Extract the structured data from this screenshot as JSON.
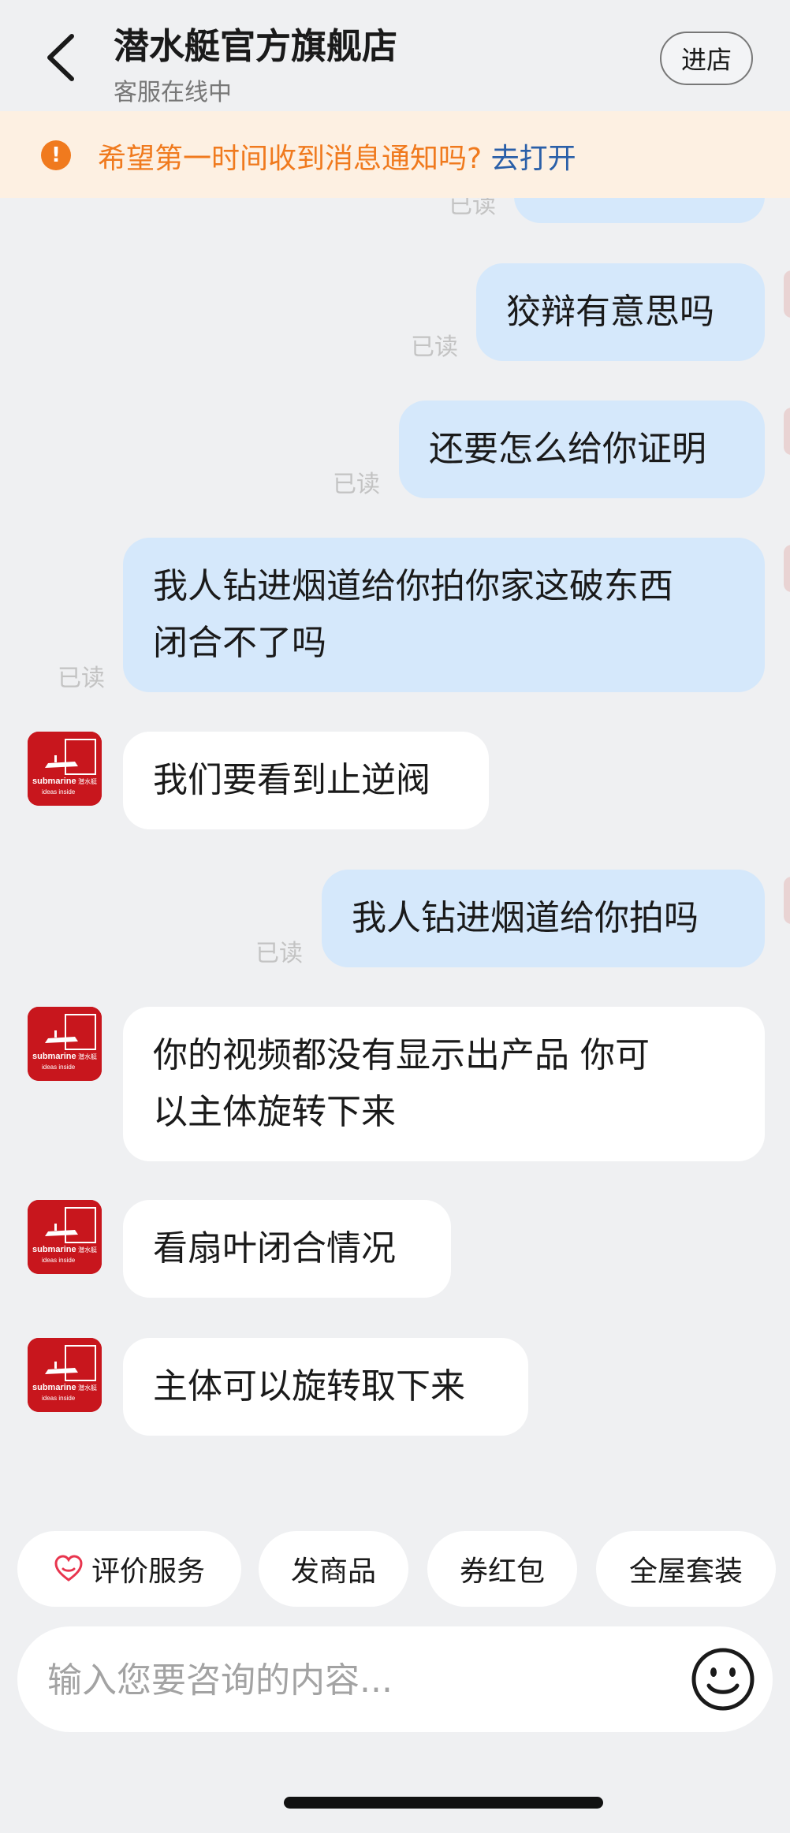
{
  "header": {
    "back_icon": "chevron-left-icon",
    "title": "潜水艇官方旗舰店",
    "status": "客服在线中",
    "enter_store_label": "进店"
  },
  "notice": {
    "icon": "alert-circle-icon",
    "text": "希望第一时间收到消息通知吗?",
    "link_text": "去打开",
    "color": "#f07a1e",
    "link_color": "#2a5fa8"
  },
  "messages": [
    {
      "sender": "user",
      "text": "",
      "read_label": "已读"
    },
    {
      "sender": "user",
      "text": "狡辩有意思吗",
      "read_label": "已读"
    },
    {
      "sender": "user",
      "text": "还要怎么给你证明",
      "read_label": "已读"
    },
    {
      "sender": "user",
      "lines": [
        "我人钻进烟道给你拍你家这破东西",
        "闭合不了吗"
      ],
      "read_label": "已读"
    },
    {
      "sender": "agent",
      "text": "我们要看到止逆阀"
    },
    {
      "sender": "user",
      "text": "我人钻进烟道给你拍吗",
      "read_label": "已读"
    },
    {
      "sender": "agent",
      "lines": [
        "你的视频都没有显示出产品 你可",
        "以主体旋转下来"
      ]
    },
    {
      "sender": "agent",
      "text": "看扇叶闭合情况"
    },
    {
      "sender": "agent",
      "text": "主体可以旋转取下来"
    }
  ],
  "agent_avatar": {
    "brand": "submarine",
    "brand_cn": "潜水艇",
    "tagline": "ideas  inside",
    "color": "#c8161d"
  },
  "quick_actions": [
    {
      "label": "评价服务",
      "icon": "heart-service-icon"
    },
    {
      "label": "发商品"
    },
    {
      "label": "券红包"
    },
    {
      "label": "全屋套装"
    }
  ],
  "input": {
    "placeholder": "输入您要咨询的内容...",
    "value": "",
    "emoji_icon": "smiley-icon"
  },
  "colors": {
    "background": "#eff0f2",
    "outgoing_bubble": "#d5e8fb",
    "incoming_bubble": "#ffffff"
  }
}
